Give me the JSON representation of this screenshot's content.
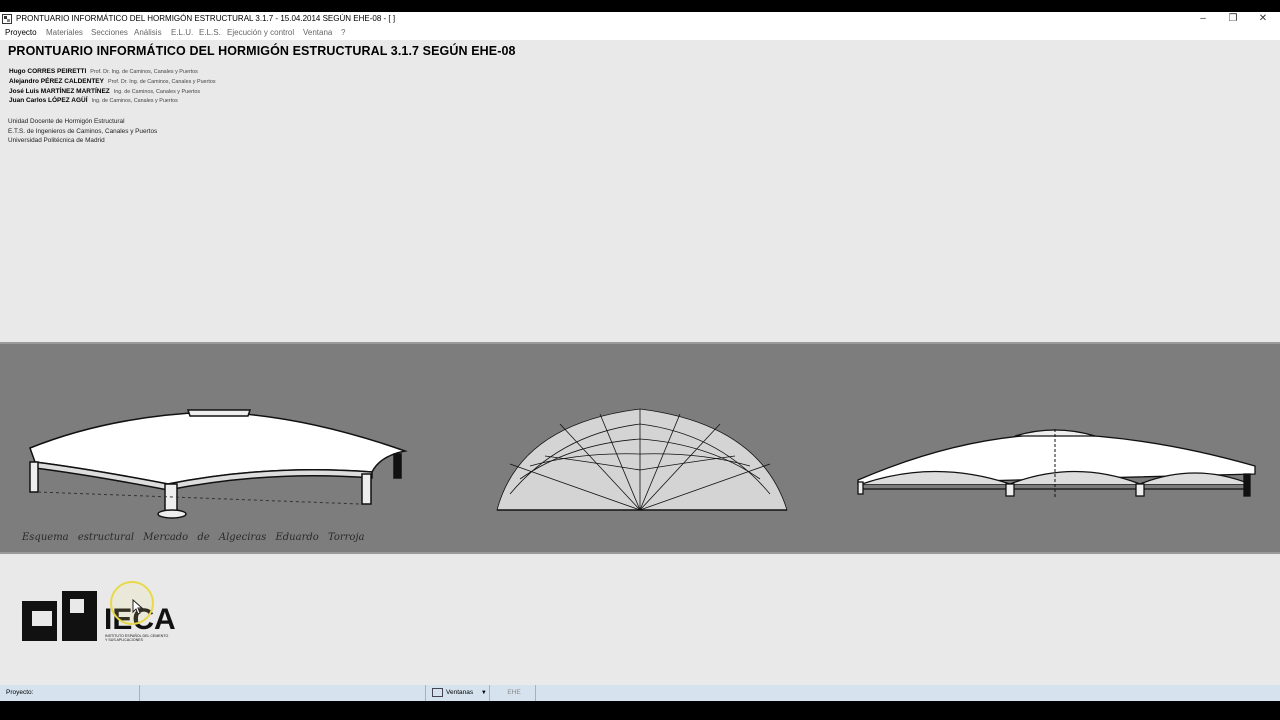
{
  "window": {
    "title": "PRONTUARIO INFORMÁTICO DEL HORMIGÓN ESTRUCTURAL 3.1.7 - 15.04.2014 SEGÚN EHE-08 - [ ]",
    "minimize": "–",
    "restore": "❐",
    "close": "✕"
  },
  "menu": [
    "Proyecto",
    "Materiales",
    "Secciones",
    "Análisis",
    "E.L.U.",
    "E.L.S.",
    "Ejecución y control",
    "Ventana",
    "?"
  ],
  "main": {
    "heading": "PRONTUARIO INFORMÁTICO DEL HORMIGÓN ESTRUCTURAL 3.1.7 SEGÚN EHE-08",
    "authors": [
      {
        "name": "Hugo CORRES PEIRETTI",
        "role": "Prof. Dr. Ing. de Caminos, Canales y Puertos"
      },
      {
        "name": "Alejandro PÉREZ CALDENTEY",
        "role": "Prof. Dr. Ing. de Caminos, Canales y Puertos"
      },
      {
        "name": "José Luis MARTÍNEZ MARTÍNEZ",
        "role": "Ing. de Caminos, Canales y Puertos"
      },
      {
        "name": "Juan Carlos LÓPEZ AGÜÍ",
        "role": "Ing. de Caminos, Canales y Puertos"
      }
    ],
    "institution": [
      "Unidad Docente de Hormigón Estructural",
      "E.T.S. de Ingenieros de Caminos, Canales y Puertos",
      "Universidad Politécnica de Madrid"
    ],
    "band_caption": "Esquema estructural Mercado de Algeciras Eduardo Torroja"
  },
  "logo": {
    "text": "IECA",
    "subtitle_line1": "INSTITUTO ESPAÑOL DEL CEMENTO",
    "subtitle_line2": "Y SUS APLICACIONES"
  },
  "statusbar": {
    "label": "Proyecto:",
    "windows": "Ventanas",
    "code": "EHE"
  }
}
